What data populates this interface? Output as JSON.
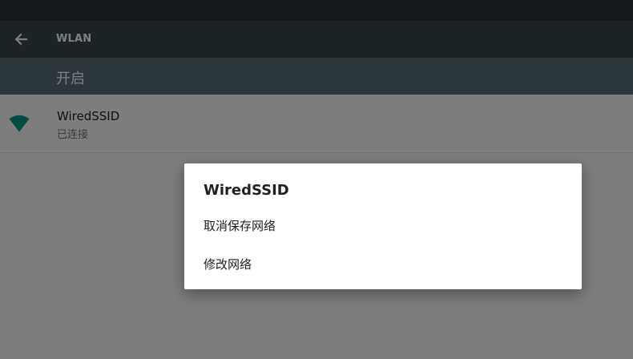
{
  "app_bar": {
    "back_icon": "arrow-back-icon",
    "title": "WLAN"
  },
  "wifi_switch": {
    "label": "开启"
  },
  "networks": [
    {
      "name": "WiredSSID",
      "status": "已连接",
      "icon": "wifi-signal-icon"
    }
  ],
  "dialog": {
    "title": "WiredSSID",
    "items": [
      {
        "label": "取消保存网络"
      },
      {
        "label": "修改网络"
      }
    ]
  },
  "colors": {
    "status_bar": "#263238",
    "app_bar": "#37474f",
    "switch_bar": "#546e7a",
    "wifi_accent": "#009688",
    "dialog_background": "#ffffff"
  }
}
